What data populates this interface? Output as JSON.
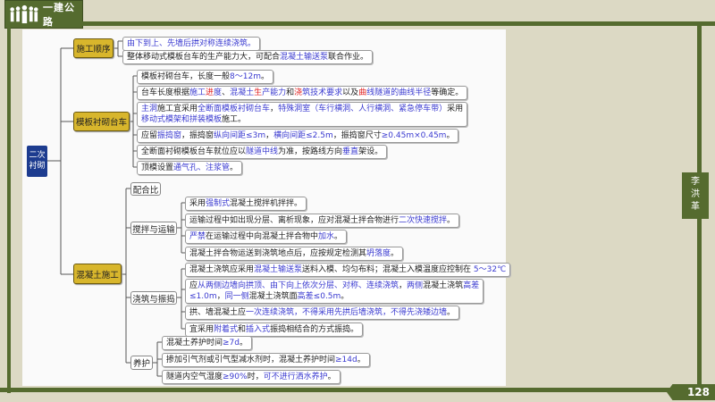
{
  "header": {
    "title": "一建公路",
    "icon": "people-icon"
  },
  "author": [
    "李",
    "洪",
    "革"
  ],
  "page_number": "128",
  "colors": {
    "accent": "#556b2f",
    "node": "#d8b62c",
    "root": "#1d3c8f",
    "blue": "#3a3ad0",
    "red": "#e02020"
  },
  "root": {
    "label": [
      "二次",
      "衬砌"
    ]
  },
  "branches": [
    {
      "label": "施工顺序",
      "items": [
        [
          {
            "t": "由下到上、先墙后拱对称连续浇筑。",
            "c": "b"
          }
        ],
        [
          {
            "t": "整体移动式模板台车的生产能力大，可配合"
          },
          {
            "t": "混凝土输送泵",
            "c": "b"
          },
          {
            "t": "联合作业。"
          }
        ]
      ]
    },
    {
      "label": "模板衬砌台车",
      "items": [
        [
          {
            "t": "模板衬砌台车，长度一般"
          },
          {
            "t": "8～12m",
            "c": "b"
          },
          {
            "t": "。"
          }
        ],
        [
          {
            "t": "台车长度根据"
          },
          {
            "t": "施工",
            "c": "b"
          },
          {
            "t": "进",
            "c": "r"
          },
          {
            "t": "度",
            "c": "b"
          },
          {
            "t": "、"
          },
          {
            "t": "混凝土",
            "c": "b"
          },
          {
            "t": "生",
            "c": "r"
          },
          {
            "t": "产能力",
            "c": "b"
          },
          {
            "t": "和"
          },
          {
            "t": "浇",
            "c": "r"
          },
          {
            "t": "筑技术要求",
            "c": "b"
          },
          {
            "t": "以及"
          },
          {
            "t": "曲",
            "c": "r"
          },
          {
            "t": "线隧道的曲线半径",
            "c": "b"
          },
          {
            "t": "等确定。"
          }
        ],
        [
          {
            "t": "主洞",
            "c": "b"
          },
          {
            "t": "施工宜采用"
          },
          {
            "t": "全断面模板衬砌台车",
            "c": "b"
          },
          {
            "t": "，"
          },
          {
            "t": "特殊洞室（车行横洞、人行横洞、紧急停车带）",
            "c": "b"
          },
          {
            "t": "采用"
          },
          {
            "br": true
          },
          {
            "t": "移动式模架和拼装模板",
            "c": "b"
          },
          {
            "t": "施工。"
          }
        ],
        [
          {
            "t": "应留"
          },
          {
            "t": "振捣窗",
            "c": "b"
          },
          {
            "t": "，振捣窗"
          },
          {
            "t": "纵向间距≤3m",
            "c": "b"
          },
          {
            "t": "，"
          },
          {
            "t": "横向间距≤2.5m",
            "c": "b"
          },
          {
            "t": "，振捣窗尺寸"
          },
          {
            "t": "≥0.45m×0.45m",
            "c": "b"
          },
          {
            "t": "。"
          }
        ],
        [
          {
            "t": "全断面衬砌模板台车就位应以"
          },
          {
            "t": "隧道中线",
            "c": "b"
          },
          {
            "t": "为准，按路线方向"
          },
          {
            "t": "垂直",
            "c": "b"
          },
          {
            "t": "架设。"
          }
        ],
        [
          {
            "t": "顶模设置"
          },
          {
            "t": "通气孔、注浆管",
            "c": "b"
          },
          {
            "t": "。"
          }
        ]
      ]
    },
    {
      "label": "混凝土施工",
      "subs": [
        {
          "label": "配合比",
          "items": []
        },
        {
          "label": "搅拌与运输",
          "items": [
            [
              {
                "t": "采用"
              },
              {
                "t": "强制式",
                "c": "b"
              },
              {
                "t": "混凝土搅拌机拌拌。"
              }
            ],
            [
              {
                "t": "运输过程中如出现分层、离析现象，应对混凝土拌合物进行"
              },
              {
                "t": "二次快速搅拌",
                "c": "b"
              },
              {
                "t": "。"
              }
            ],
            [
              {
                "t": "严禁",
                "c": "b"
              },
              {
                "t": "在运输过程中向混凝土拌合物中"
              },
              {
                "t": "加水",
                "c": "b"
              },
              {
                "t": "。"
              }
            ],
            [
              {
                "t": "混凝土拌合物运送到浇筑地点后，应按规定检测其"
              },
              {
                "t": "坍落度",
                "c": "b"
              },
              {
                "t": "。"
              }
            ]
          ]
        },
        {
          "label": "浇筑与振捣",
          "items": [
            [
              {
                "t": "混凝土浇筑应采用"
              },
              {
                "t": "混凝土输送泵",
                "c": "b"
              },
              {
                "t": "送料入模、均匀布料；混凝土入模温度应控制在 "
              },
              {
                "t": "5～32℃",
                "c": "b"
              }
            ],
            [
              {
                "t": "应"
              },
              {
                "t": "从两侧边墙向拱顶、由下向上依次分层、对称、连续浇筑",
                "c": "b"
              },
              {
                "t": "，"
              },
              {
                "t": "两侧",
                "c": "b"
              },
              {
                "t": "混凝土浇筑"
              },
              {
                "t": "高差",
                "c": "b"
              },
              {
                "br": true
              },
              {
                "t": "≤1.0m",
                "c": "b"
              },
              {
                "t": "，"
              },
              {
                "t": "同一侧",
                "c": "b"
              },
              {
                "t": "混凝土浇筑面"
              },
              {
                "t": "高差≤0.5m",
                "c": "b"
              },
              {
                "t": "。"
              }
            ],
            [
              {
                "t": "拱、墙混凝土应"
              },
              {
                "t": "一次连续浇筑，不得采用先拱后墙浇筑，不得先浇矮边墙",
                "c": "b"
              },
              {
                "t": "。"
              }
            ],
            [
              {
                "t": "宜采用"
              },
              {
                "t": "附着式",
                "c": "b"
              },
              {
                "t": "和"
              },
              {
                "t": "插入式",
                "c": "b"
              },
              {
                "t": "振捣相结合的方式振捣。"
              }
            ]
          ]
        },
        {
          "label": "养护",
          "items": [
            [
              {
                "t": "混凝土养护时间"
              },
              {
                "t": "≥7d",
                "c": "b"
              },
              {
                "t": "。"
              }
            ],
            [
              {
                "t": "掺加引气剂或引气型减水剂时，混凝土养护时间"
              },
              {
                "t": "≥14d",
                "c": "b"
              },
              {
                "t": "。"
              }
            ],
            [
              {
                "t": "隧道内空气湿度"
              },
              {
                "t": "≥90%",
                "c": "b"
              },
              {
                "t": "时，"
              },
              {
                "t": "可不进行洒水养护",
                "c": "b"
              },
              {
                "t": "。"
              }
            ]
          ]
        }
      ]
    }
  ]
}
